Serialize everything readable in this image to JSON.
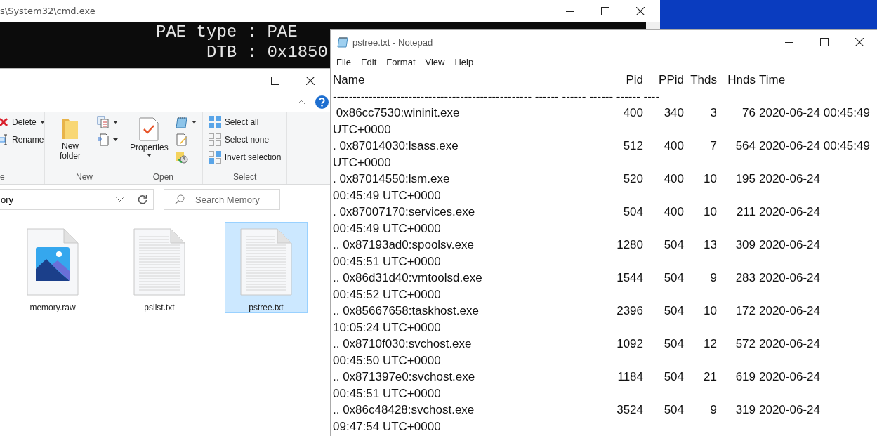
{
  "console_window": {
    "title": "s\\System32\\cmd.exe",
    "lines": [
      "PAE type : PAE",
      "     DTB : 0x1850"
    ]
  },
  "explorer_window": {
    "ribbon": {
      "groups": [
        {
          "label": "e",
          "items": [
            {
              "kind": "small",
              "label": "Delete"
            },
            {
              "kind": "small",
              "label": "Rename"
            }
          ]
        },
        {
          "label": "New",
          "items": [
            {
              "kind": "large",
              "label": "New folder"
            },
            {
              "kind": "icononly"
            },
            {
              "kind": "icononly"
            }
          ]
        },
        {
          "label": "Open",
          "items": [
            {
              "kind": "large",
              "label": "Properties"
            },
            {
              "kind": "icononly"
            },
            {
              "kind": "icononly"
            },
            {
              "kind": "icononly"
            }
          ]
        },
        {
          "label": "Select",
          "items": [
            {
              "kind": "small",
              "label": "Select all"
            },
            {
              "kind": "small",
              "label": "Select none"
            },
            {
              "kind": "small",
              "label": "Invert selection"
            }
          ]
        }
      ]
    },
    "address": "ory",
    "search": {
      "placeholder": "Search Memory"
    },
    "files": [
      {
        "name": "memory.raw",
        "kind": "image",
        "selected": false
      },
      {
        "name": "pslist.txt",
        "kind": "text",
        "selected": false
      },
      {
        "name": "pstree.txt",
        "kind": "text",
        "selected": true
      }
    ]
  },
  "notepad_window": {
    "title": "pstree.txt - Notepad",
    "menu": [
      "File",
      "Edit",
      "Format",
      "View",
      "Help"
    ],
    "columns": [
      "Name",
      "Pid",
      "PPid",
      "Thds",
      "Hnds",
      "Time"
    ],
    "rule": "-------------------------------------------------- ------ ------ ------ ------ ----",
    "rows": [
      {
        "name": " 0x86cc7530:wininit.exe",
        "pid": "400",
        "ppid": "340",
        "thds": "3",
        "hnds": "76",
        "time": "2020-06-24 00:45:49",
        "time_wrap": "UTC+0000"
      },
      {
        "name": ". 0x87014030:lsass.exe",
        "pid": "512",
        "ppid": "400",
        "thds": "7",
        "hnds": "564",
        "time": "2020-06-24 00:45:49",
        "time_wrap": "UTC+0000"
      },
      {
        "name": ". 0x87014550:lsm.exe",
        "pid": "520",
        "ppid": "400",
        "thds": "10",
        "hnds": "195",
        "time": "2020-06-24",
        "time_wrap": "00:45:49 UTC+0000"
      },
      {
        "name": ". 0x87007170:services.exe",
        "pid": "504",
        "ppid": "400",
        "thds": "10",
        "hnds": "211",
        "time": "2020-06-24",
        "time_wrap": "00:45:49 UTC+0000"
      },
      {
        "name": ".. 0x87193ad0:spoolsv.exe",
        "pid": "1280",
        "ppid": "504",
        "thds": "13",
        "hnds": "309",
        "time": "2020-06-24",
        "time_wrap": "00:45:51 UTC+0000"
      },
      {
        "name": ".. 0x86d31d40:vmtoolsd.exe",
        "pid": "1544",
        "ppid": "504",
        "thds": "9",
        "hnds": "283",
        "time": "2020-06-24",
        "time_wrap": "00:45:52 UTC+0000"
      },
      {
        "name": ".. 0x85667658:taskhost.exe",
        "pid": "2396",
        "ppid": "504",
        "thds": "10",
        "hnds": "172",
        "time": "2020-06-24",
        "time_wrap": "10:05:24 UTC+0000"
      },
      {
        "name": ".. 0x8710f030:svchost.exe",
        "pid": "1092",
        "ppid": "504",
        "thds": "12",
        "hnds": "572",
        "time": "2020-06-24",
        "time_wrap": "00:45:50 UTC+0000"
      },
      {
        "name": ".. 0x871397e0:svchost.exe",
        "pid": "1184",
        "ppid": "504",
        "thds": "21",
        "hnds": "619",
        "time": "2020-06-24",
        "time_wrap": "00:45:51 UTC+0000"
      },
      {
        "name": ".. 0x86c48428:svchost.exe",
        "pid": "3524",
        "ppid": "504",
        "thds": "9",
        "hnds": "319",
        "time": "2020-06-24",
        "time_wrap": "09:47:54 UTC+0000"
      }
    ]
  }
}
